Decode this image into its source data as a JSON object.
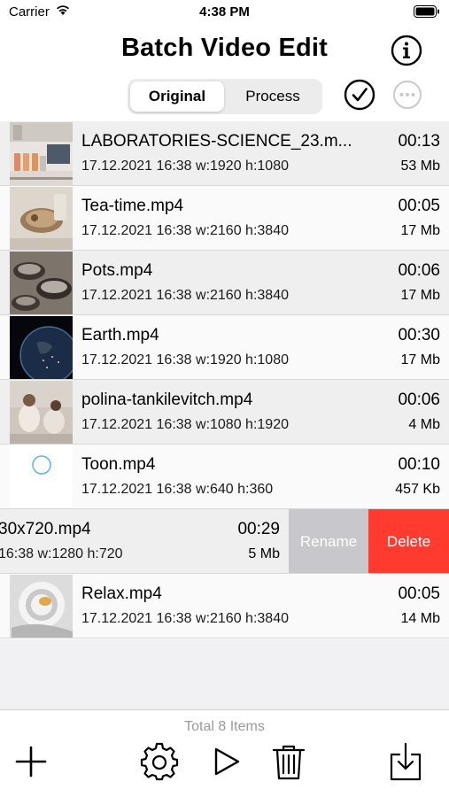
{
  "status": {
    "carrier": "Carrier",
    "time": "4:38 PM"
  },
  "header": {
    "title": "Batch Video Edit"
  },
  "segments": [
    {
      "label": "Original",
      "selected": true
    },
    {
      "label": "Process",
      "selected": false
    }
  ],
  "videos": [
    {
      "name": "LABORATORIES-SCIENCE_23.m...",
      "meta": "17.12.2021 16:38 w:1920 h:1080",
      "duration": "00:13",
      "size": "53 Mb"
    },
    {
      "name": "Tea-time.mp4",
      "meta": "17.12.2021 16:38 w:2160 h:3840",
      "duration": "00:05",
      "size": "17 Mb"
    },
    {
      "name": "Pots.mp4",
      "meta": "17.12.2021 16:38 w:2160 h:3840",
      "duration": "00:06",
      "size": "17 Mb"
    },
    {
      "name": "Earth.mp4",
      "meta": "17.12.2021 16:38 w:1920 h:1080",
      "duration": "00:30",
      "size": "17 Mb"
    },
    {
      "name": "polina-tankilevitch.mp4",
      "meta": "17.12.2021 16:38 w:1080 h:1920",
      "duration": "00:06",
      "size": "4 Mb"
    },
    {
      "name": "Toon.mp4",
      "meta": "17.12.2021 16:38 w:640 h:360",
      "duration": "00:10",
      "size": "457 Kb"
    },
    {
      "name": "30x720.mp4",
      "meta": "16:38 w:1280 h:720",
      "duration": "00:29",
      "size": "5 Mb"
    },
    {
      "name": "Relax.mp4",
      "meta": "17.12.2021 16:38 w:2160 h:3840",
      "duration": "00:05",
      "size": "14 Mb"
    }
  ],
  "swipe_actions": {
    "rename": "Rename",
    "delete": "Delete"
  },
  "footer": {
    "total": "Total 8 Items"
  },
  "colors": {
    "delete": "#ff3b30",
    "rename": "#c7c7cc",
    "row_shade": "#efefef",
    "toon_circle": "#5ab4e6"
  },
  "icons": {
    "info": "info-icon",
    "check": "checkmark-circle-icon",
    "more": "ellipsis-circle-icon",
    "add": "plus-icon",
    "settings": "gear-icon",
    "play": "play-icon",
    "trash": "trash-icon",
    "export": "download-icon"
  }
}
